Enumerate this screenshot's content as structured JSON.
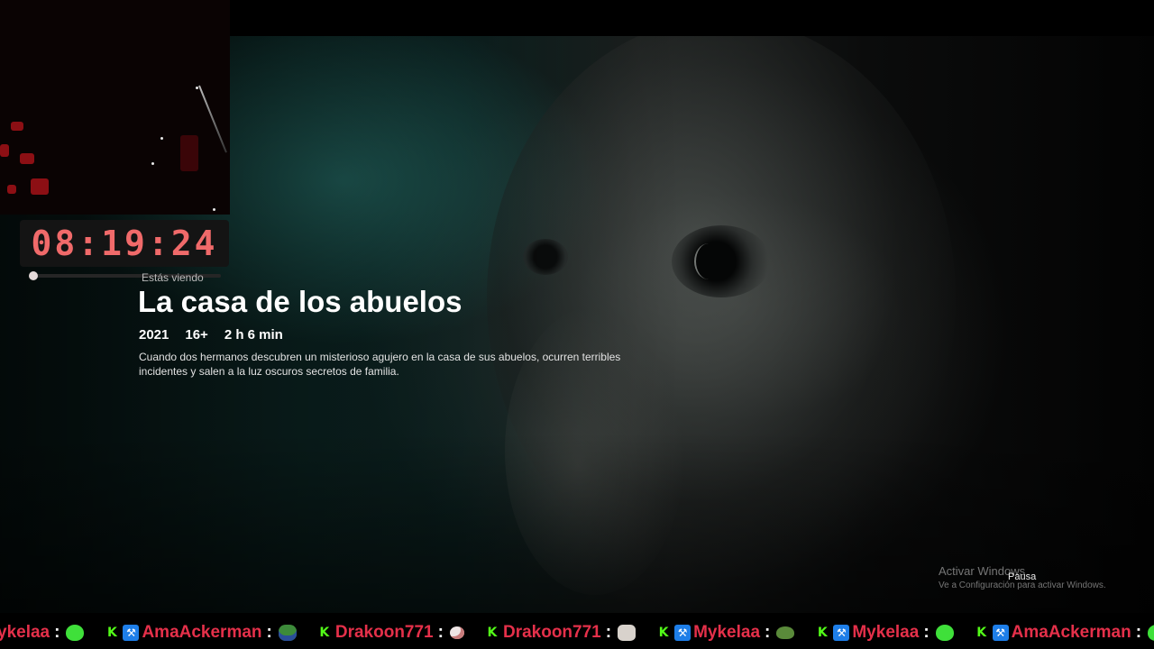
{
  "timer": {
    "value": "08:19:24"
  },
  "progress": {
    "fraction": 0.02
  },
  "info": {
    "watching_label": "Estás viendo",
    "title": "La casa de los abuelos",
    "year": "2021",
    "rating": "16+",
    "duration": "2 h 6 min",
    "synopsis": "Cuando dos hermanos descubren un misterioso agujero en la casa de sus abuelos, ocurren terribles incidentes y salen a la luz oscuros secretos de familia."
  },
  "watermark": {
    "title": "Activar Windows",
    "subtitle": "Ve a Configuración para activar Windows."
  },
  "tooltip": {
    "label": "Pausa"
  },
  "chat": {
    "messages": [
      {
        "user": "ykelaa",
        "badges": [],
        "emote": "green-blob"
      },
      {
        "user": "AmaAckerman",
        "badges": [
          "kick-badge",
          "moderator-hammer"
        ],
        "emote": "pepe-hat"
      },
      {
        "user": "Drakoon771",
        "badges": [
          "kick-badge"
        ],
        "emote": "sheep"
      },
      {
        "user": "Drakoon771",
        "badges": [
          "kick-badge"
        ],
        "emote": "cat"
      },
      {
        "user": "Mykelaa",
        "badges": [
          "kick-badge",
          "moderator-hammer"
        ],
        "emote": "frog"
      },
      {
        "user": "Mykelaa",
        "badges": [
          "kick-badge",
          "moderator-hammer"
        ],
        "emote": "green-blob"
      },
      {
        "user": "AmaAckerman",
        "badges": [
          "kick-badge",
          "moderator-hammer"
        ],
        "emote": "green-blob"
      }
    ],
    "badge_glyphs": {
      "kick-badge": "K",
      "moderator-hammer": "⚒"
    },
    "colon": ":"
  },
  "colors": {
    "username": "#e5304a",
    "timer": "#f06a6a",
    "kick_green": "#53fc18"
  }
}
